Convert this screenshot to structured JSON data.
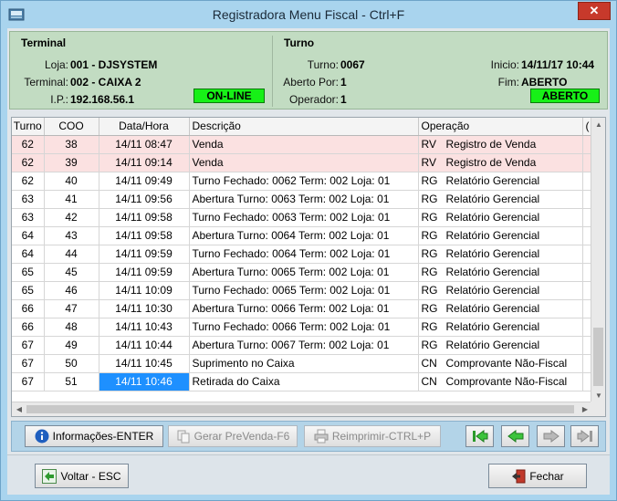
{
  "window": {
    "title": "Registradora      Menu Fiscal - Ctrl+F",
    "close_label": "✕"
  },
  "terminal": {
    "section_title": "Terminal",
    "loja_label": "Loja:",
    "loja_value": "001 - DJSYSTEM",
    "terminal_label": "Terminal:",
    "terminal_value": "002 - CAIXA 2",
    "ip_label": "I.P.:",
    "ip_value": "192.168.56.1",
    "status": "ON-LINE"
  },
  "turno": {
    "section_title": "Turno",
    "turno_label": "Turno:",
    "turno_value": "0067",
    "aberto_por_label": "Aberto Por:",
    "aberto_por_value": "1",
    "operador_label": "Operador:",
    "operador_value": "1",
    "inicio_label": "Inicio:",
    "inicio_value": "14/11/17 10:44",
    "fim_label": "Fim:",
    "fim_value": "ABERTO",
    "status": "ABERTO"
  },
  "grid": {
    "columns": [
      "Turno",
      "COO",
      "Data/Hora",
      "Descrição",
      "Operação",
      "("
    ],
    "rows": [
      {
        "turno": "62",
        "coo": "38",
        "data": "14/11 08:47",
        "descricao": "Venda",
        "op_code": "RV",
        "op_desc": "Registro de Venda"
      },
      {
        "turno": "62",
        "coo": "39",
        "data": "14/11 09:14",
        "descricao": "Venda",
        "op_code": "RV",
        "op_desc": "Registro de Venda"
      },
      {
        "turno": "62",
        "coo": "40",
        "data": "14/11 09:49",
        "descricao": "Turno Fechado: 0062 Term: 002 Loja: 01",
        "op_code": "RG",
        "op_desc": "Relatório Gerencial"
      },
      {
        "turno": "63",
        "coo": "41",
        "data": "14/11 09:56",
        "descricao": "Abertura Turno: 0063 Term: 002 Loja: 01",
        "op_code": "RG",
        "op_desc": "Relatório Gerencial"
      },
      {
        "turno": "63",
        "coo": "42",
        "data": "14/11 09:58",
        "descricao": "Turno Fechado: 0063 Term: 002 Loja: 01",
        "op_code": "RG",
        "op_desc": "Relatório Gerencial"
      },
      {
        "turno": "64",
        "coo": "43",
        "data": "14/11 09:58",
        "descricao": "Abertura Turno: 0064 Term: 002 Loja: 01",
        "op_code": "RG",
        "op_desc": "Relatório Gerencial"
      },
      {
        "turno": "64",
        "coo": "44",
        "data": "14/11 09:59",
        "descricao": "Turno Fechado: 0064 Term: 002 Loja: 01",
        "op_code": "RG",
        "op_desc": "Relatório Gerencial"
      },
      {
        "turno": "65",
        "coo": "45",
        "data": "14/11 09:59",
        "descricao": "Abertura Turno: 0065 Term: 002 Loja: 01",
        "op_code": "RG",
        "op_desc": "Relatório Gerencial"
      },
      {
        "turno": "65",
        "coo": "46",
        "data": "14/11 10:09",
        "descricao": "Turno Fechado: 0065 Term: 002 Loja: 01",
        "op_code": "RG",
        "op_desc": "Relatório Gerencial"
      },
      {
        "turno": "66",
        "coo": "47",
        "data": "14/11 10:30",
        "descricao": "Abertura Turno: 0066 Term: 002 Loja: 01",
        "op_code": "RG",
        "op_desc": "Relatório Gerencial"
      },
      {
        "turno": "66",
        "coo": "48",
        "data": "14/11 10:43",
        "descricao": "Turno Fechado: 0066 Term: 002 Loja: 01",
        "op_code": "RG",
        "op_desc": "Relatório Gerencial"
      },
      {
        "turno": "67",
        "coo": "49",
        "data": "14/11 10:44",
        "descricao": "Abertura Turno: 0067 Term: 002 Loja: 01",
        "op_code": "RG",
        "op_desc": "Relatório Gerencial"
      },
      {
        "turno": "67",
        "coo": "50",
        "data": "14/11 10:45",
        "descricao": "Suprimento no Caixa",
        "op_code": "CN",
        "op_desc": "Comprovante Não-Fiscal"
      },
      {
        "turno": "67",
        "coo": "51",
        "data": "14/11 10:46",
        "descricao": "Retirada do Caixa",
        "op_code": "CN",
        "op_desc": "Comprovante Não-Fiscal"
      }
    ]
  },
  "toolbar": {
    "info_label": "Informações-ENTER",
    "prevenda_label": "Gerar PreVenda-F6",
    "reimprimir_label": "Reimprimir-CTRL+P"
  },
  "footer": {
    "voltar_label": "Voltar - ESC",
    "fechar_label": "Fechar"
  },
  "colors": {
    "online_green": "#17f017",
    "row_pink": "#fbe1e1",
    "selection_blue": "#1e90ff",
    "panel_green": "#c2dcc2"
  }
}
